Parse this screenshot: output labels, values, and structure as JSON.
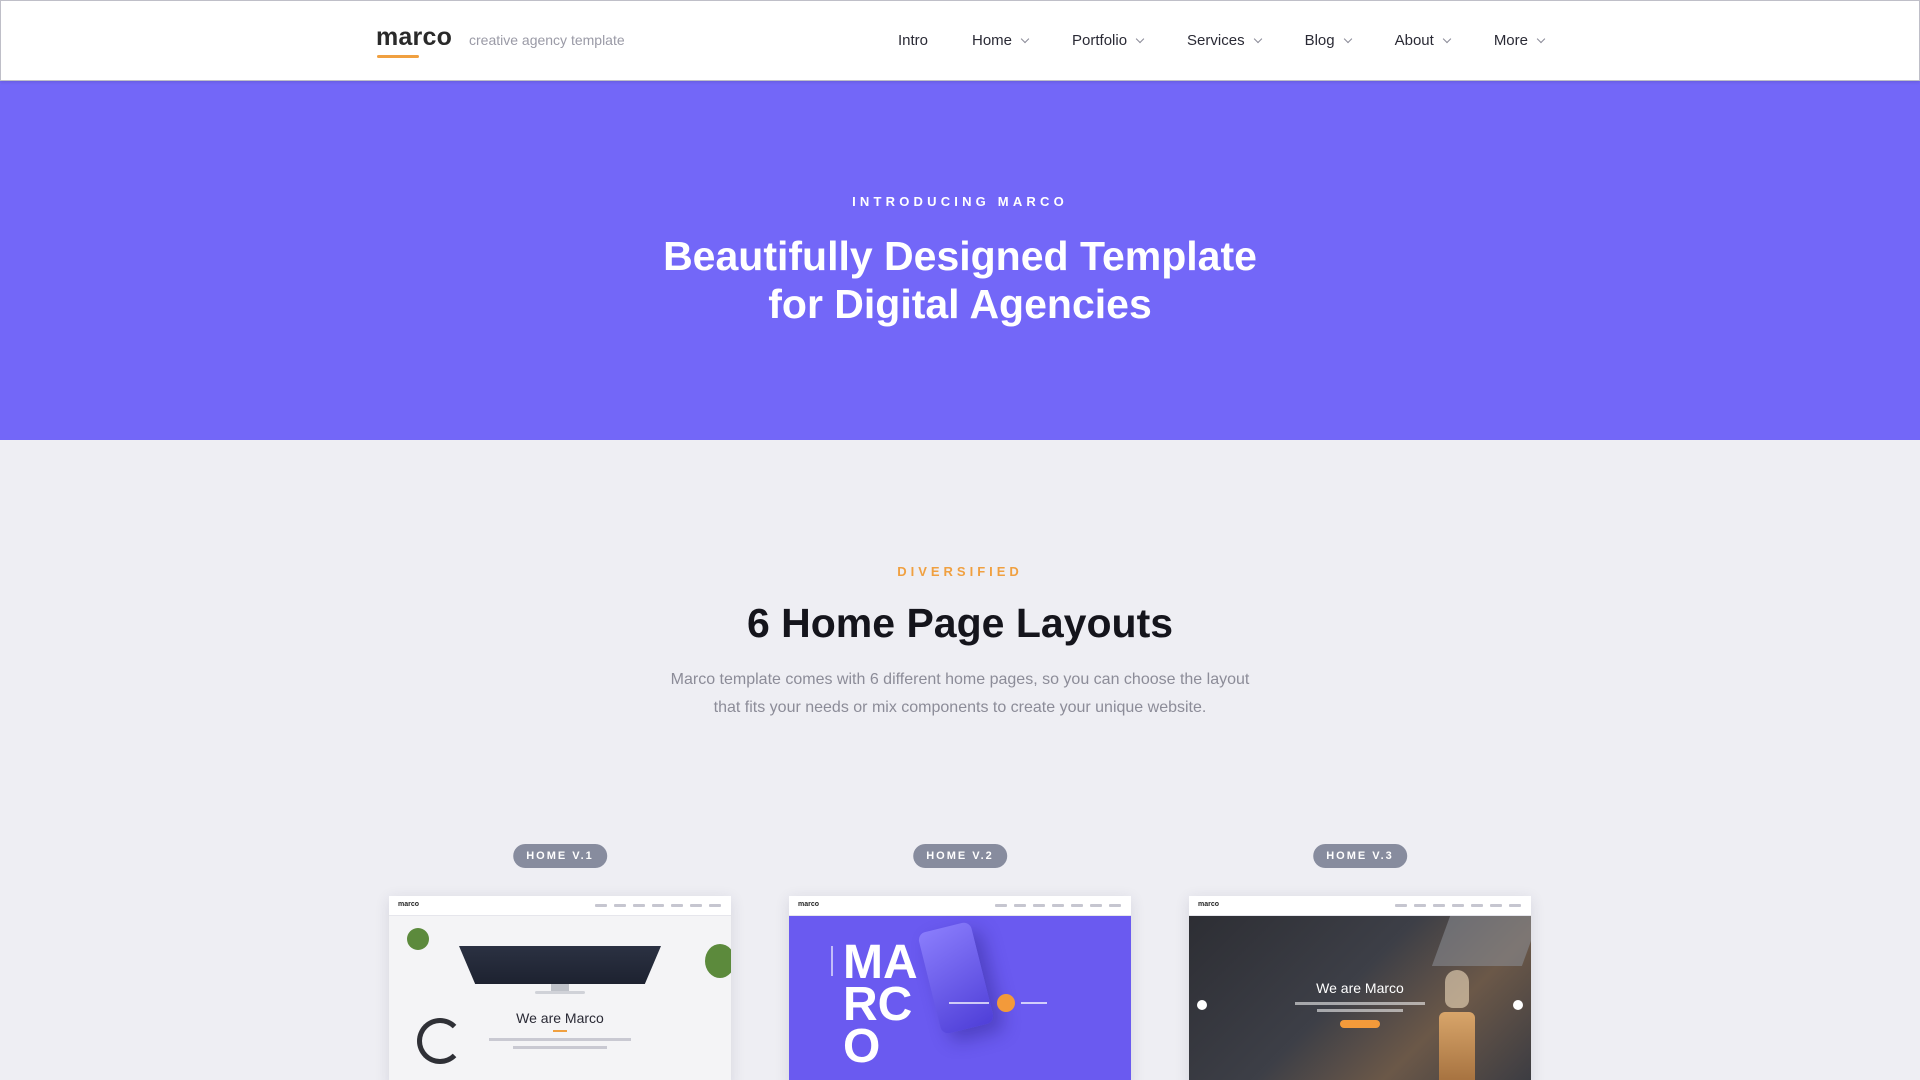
{
  "header": {
    "brand": "marco",
    "tagline": "creative agency template",
    "nav": [
      {
        "label": "Intro",
        "has_dropdown": false
      },
      {
        "label": "Home",
        "has_dropdown": true
      },
      {
        "label": "Portfolio",
        "has_dropdown": true
      },
      {
        "label": "Services",
        "has_dropdown": true
      },
      {
        "label": "Blog",
        "has_dropdown": true
      },
      {
        "label": "About",
        "has_dropdown": true
      },
      {
        "label": "More",
        "has_dropdown": true
      }
    ]
  },
  "hero": {
    "eyebrow": "INTRODUCING MARCO",
    "title_line1": "Beautifully Designed Template",
    "title_line2": "for Digital Agencies",
    "background_color": "#7367f8"
  },
  "layouts_section": {
    "eyebrow": "DIVERSIFIED",
    "title": "6 Home Page Layouts",
    "description_line1": "Marco template comes with 6 different home pages, so you can choose the layout",
    "description_line2": "that fits your needs or mix components to create your unique website.",
    "accent_color": "#f0a040",
    "cards": [
      {
        "badge": "HOME V.1",
        "preview_heading": "We are Marco",
        "preview_theme": "light"
      },
      {
        "badge": "HOME V.2",
        "preview_heading": "MARCO",
        "preview_letters": [
          "MA",
          "RC",
          "O"
        ],
        "preview_theme": "purple"
      },
      {
        "badge": "HOME V.3",
        "preview_heading": "We are Marco",
        "preview_theme": "dark-photo"
      }
    ]
  }
}
